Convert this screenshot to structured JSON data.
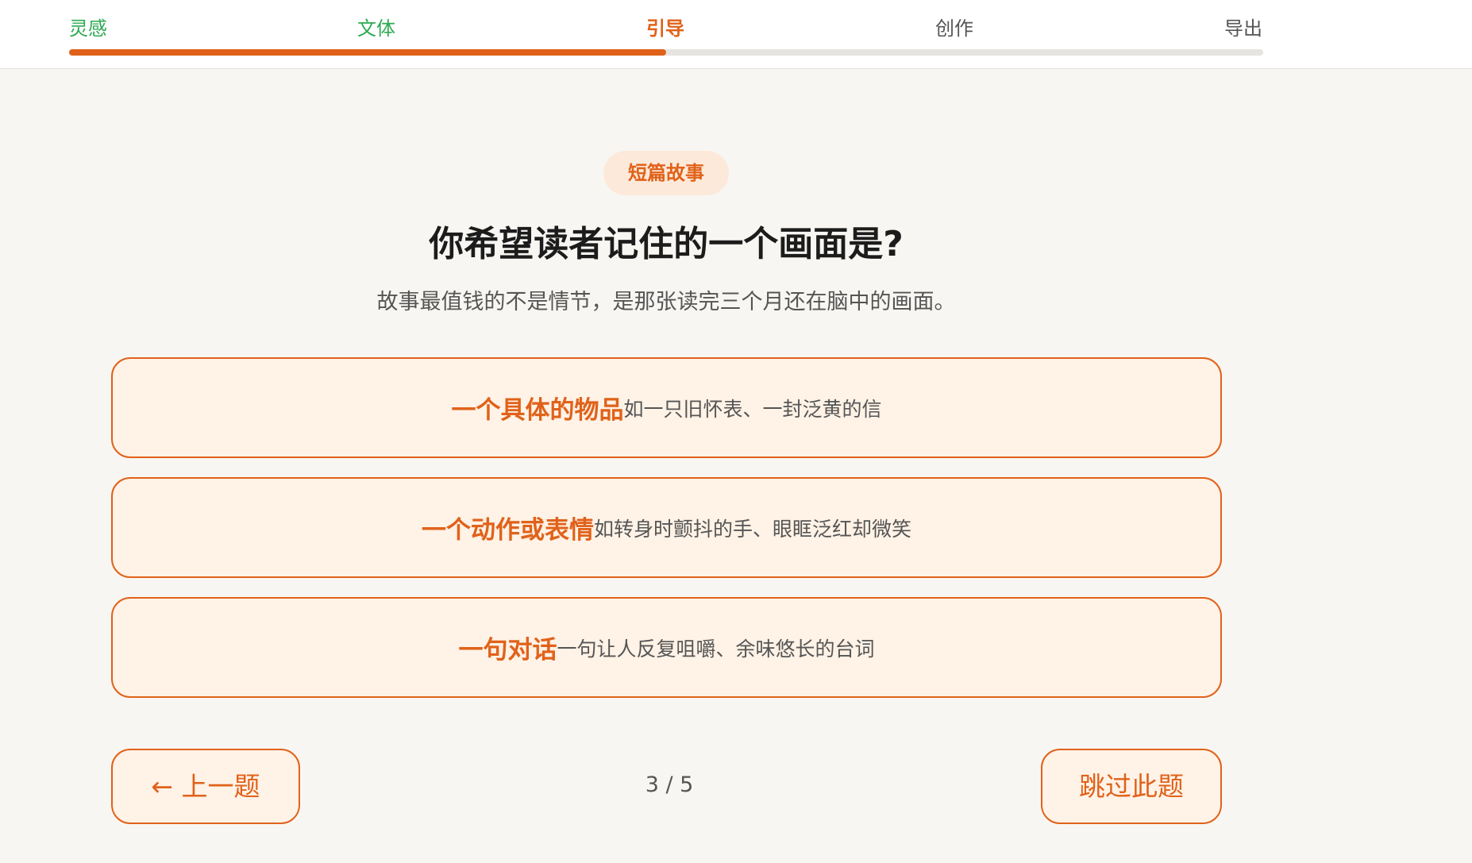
{
  "steps": [
    {
      "label": "灵感",
      "state": "done"
    },
    {
      "label": "文体",
      "state": "done"
    },
    {
      "label": "引导",
      "state": "active"
    },
    {
      "label": "创作",
      "state": "pending"
    },
    {
      "label": "导出",
      "state": "pending"
    }
  ],
  "progress": {
    "fraction": 0.5
  },
  "tag": "短篇故事",
  "question": "你希望读者记住的一个画面是?",
  "hint": "故事最值钱的不是情节，是那张读完三个月还在脑中的画面。",
  "options": [
    {
      "title": "一个具体的物品",
      "desc": "如一只旧怀表、一封泛黄的信"
    },
    {
      "title": "一个动作或表情",
      "desc": "如转身时颤抖的手、眼眶泛红却微笑"
    },
    {
      "title": "一句对话",
      "desc": "一句让人反复咀嚼、余味悠长的台词"
    }
  ],
  "nav": {
    "prev_label": "← 上一题",
    "skip_label": "跳过此题",
    "page_indicator": "3 / 5"
  },
  "colors": {
    "accent": "#e0621a",
    "done": "#2eaa52",
    "option_bg": "#fff2e6",
    "page_bg": "#f8f6f2"
  }
}
